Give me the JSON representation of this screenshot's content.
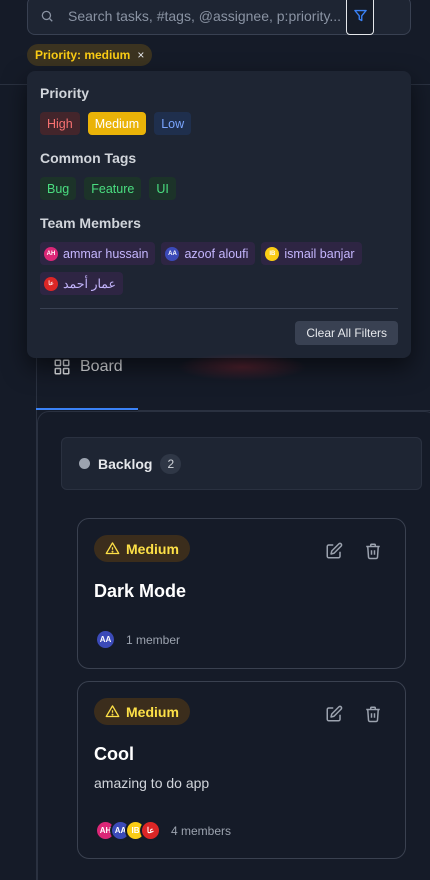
{
  "search": {
    "placeholder": "Search tasks, #tags, @assignee, p:priority..."
  },
  "active_filter": {
    "label": "Priority: medium",
    "remove": "×"
  },
  "dropdown": {
    "priority_title": "Priority",
    "priorities": [
      "High",
      "Medium",
      "Low"
    ],
    "tags_title": "Common Tags",
    "tags": [
      "Bug",
      "Feature",
      "UI"
    ],
    "members_title": "Team Members",
    "members": [
      {
        "initials": "AH",
        "name": "ammar hussain",
        "color": "#db2777"
      },
      {
        "initials": "AA",
        "name": "azoof aloufi",
        "color": "#3b4ab8"
      },
      {
        "initials": "IB",
        "name": "ismail banjar",
        "color": "#facc15"
      },
      {
        "initials": "عا",
        "name": "عمار أحمد",
        "color": "#dc2626"
      }
    ],
    "clear_label": "Clear All Filters"
  },
  "tabs": {
    "board_label": "Board"
  },
  "column": {
    "title": "Backlog",
    "count": "2"
  },
  "cards": [
    {
      "priority": "Medium",
      "title": "Dark Mode",
      "members_label": "1 member",
      "avatars": [
        {
          "initials": "AA",
          "color": "#3b4ab8"
        }
      ]
    },
    {
      "priority": "Medium",
      "title": "Cool",
      "description": "amazing to do app",
      "members_label": "4 members",
      "avatars": [
        {
          "initials": "AH",
          "color": "#db2777"
        },
        {
          "initials": "AA",
          "color": "#3b4ab8"
        },
        {
          "initials": "IB",
          "color": "#facc15"
        },
        {
          "initials": "عا",
          "color": "#dc2626"
        }
      ]
    }
  ],
  "colors": {
    "accent": "#3b82f6",
    "medium": "#eab308",
    "background": "#151b28"
  }
}
